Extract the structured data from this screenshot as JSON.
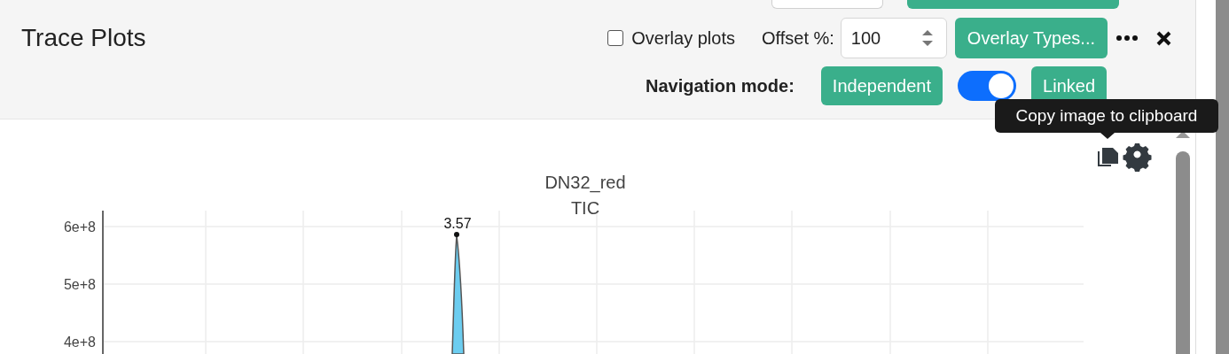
{
  "panel": {
    "title": "Trace Plots"
  },
  "toolbar": {
    "overlay_plots": {
      "label": "Overlay plots",
      "checked": false
    },
    "offset": {
      "label": "Offset %:",
      "value": "100"
    },
    "overlay_types": "Overlay Types..."
  },
  "navigation": {
    "label": "Navigation mode:",
    "options": [
      {
        "label": "Independent"
      },
      {
        "label": "Linked"
      }
    ],
    "linked_on": true
  },
  "tooltip": "Copy image to clipboard",
  "chart": {
    "title_lines": [
      "DN32_red",
      "TIC"
    ],
    "yticks": [
      "6e+8",
      "5e+8",
      "4e+8"
    ],
    "peak_label": "3.57"
  }
}
